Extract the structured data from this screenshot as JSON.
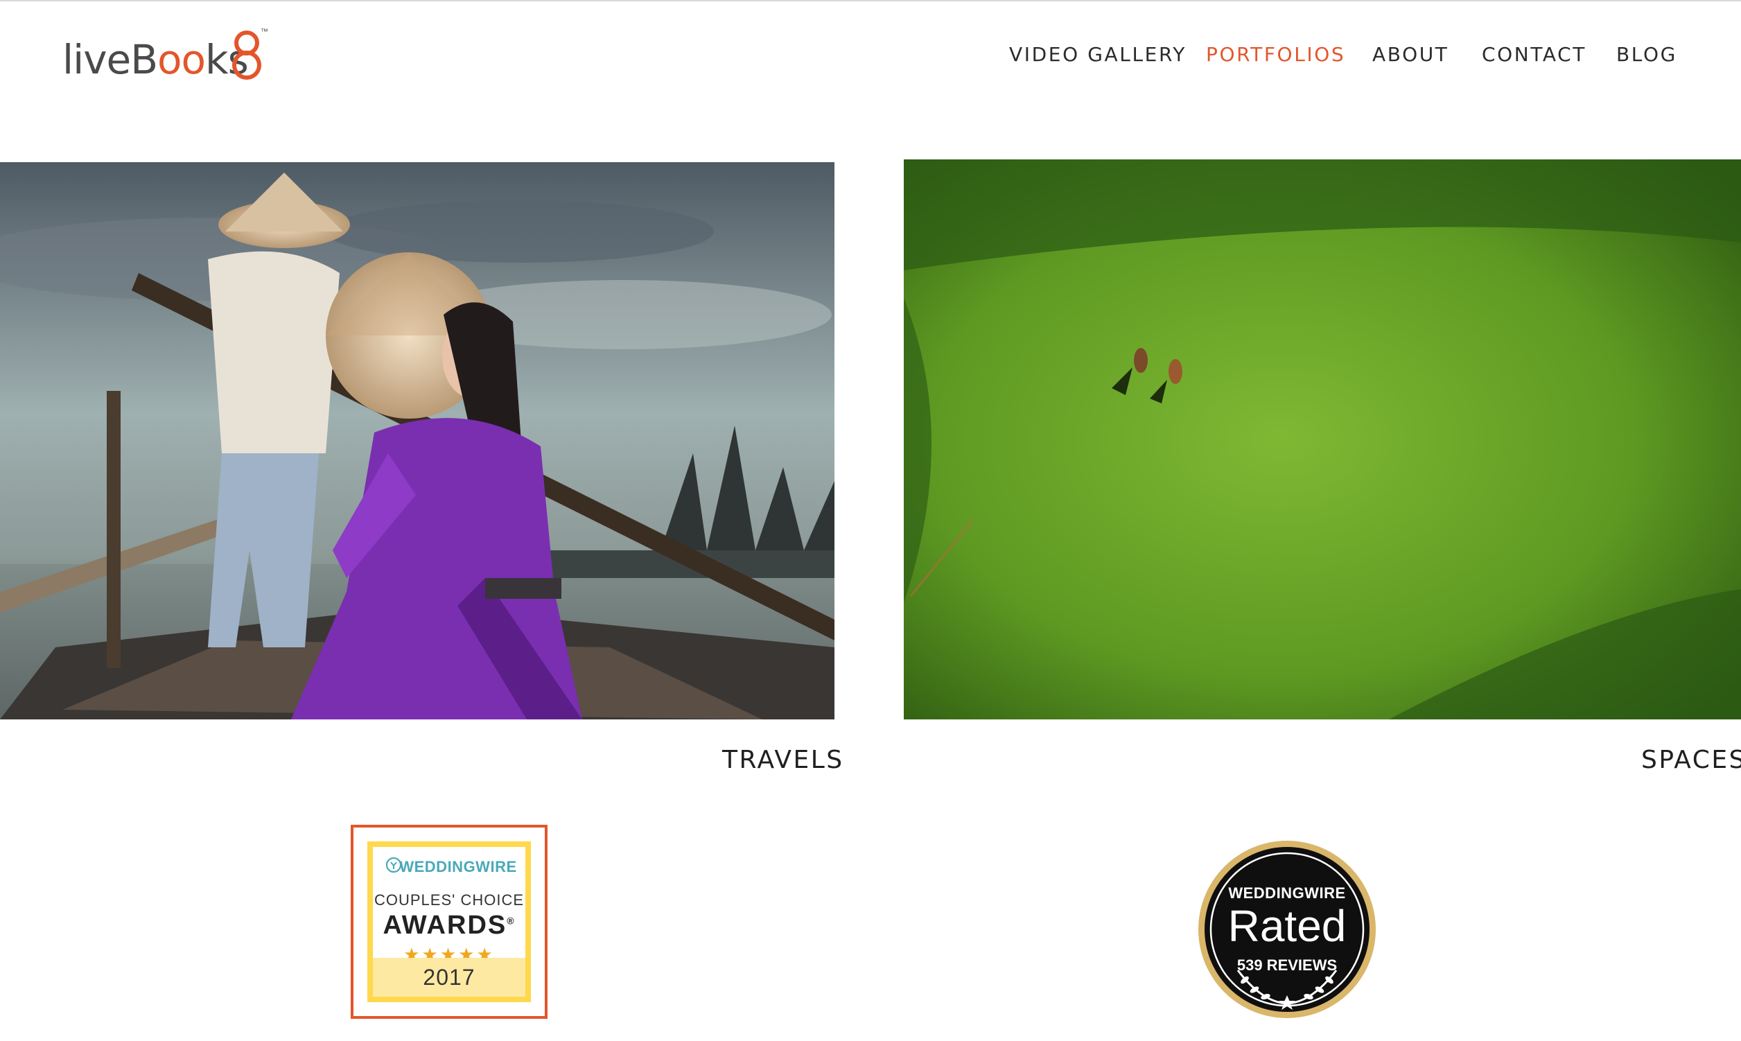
{
  "brand": {
    "logo_text_1": "liveB",
    "logo_text_o1": "o",
    "logo_text_o2": "o",
    "logo_text_2": "ks",
    "logo_tm": "™"
  },
  "nav": {
    "items": [
      {
        "label": "VIDEO GALLERY"
      },
      {
        "label": "PORTFOLIOS",
        "active": true
      },
      {
        "label": "ABOUT"
      },
      {
        "label": "CONTACT"
      },
      {
        "label": "BLOG"
      }
    ]
  },
  "portfolios": [
    {
      "caption": "TRAVELS"
    },
    {
      "caption": "SPACES"
    }
  ],
  "badges": {
    "couples_choice": {
      "brand": "WEDDINGWIRE",
      "subtitle": "COUPLES' CHOICE",
      "title": "AWARDS",
      "registered": "®",
      "stars": "★★★★★",
      "year": "2017"
    },
    "rated": {
      "brand": "WEDDINGWIRE",
      "title": "Rated",
      "reviews": "539 REVIEWS"
    }
  },
  "colors": {
    "accent": "#e3562b",
    "text": "#2b2b2b",
    "award_yellow": "#ffd84d",
    "award_teal": "#4aa9b8",
    "badge_gold": "#d9b66a"
  }
}
